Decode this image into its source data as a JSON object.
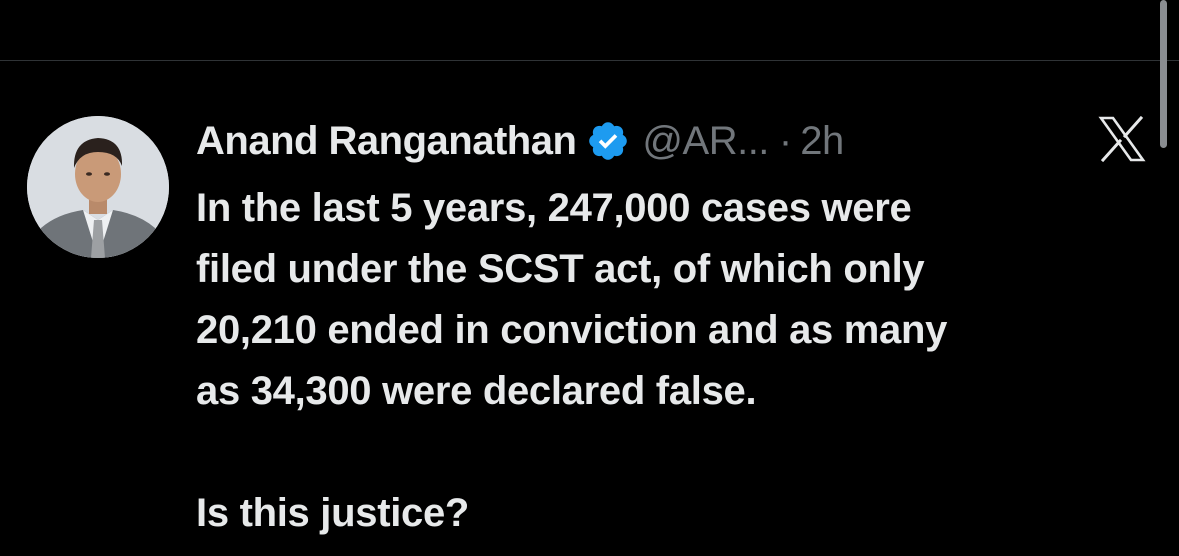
{
  "tweet": {
    "author_name": "Anand Ranganathan",
    "handle": "@AR...",
    "separator": "·",
    "time": "2h",
    "verified": true,
    "body_lines": [
      "In the last 5 years, 247,000 cases were",
      "filed under the SCST act, of which only",
      "20,210 ended in conviction and as many",
      "as 34,300 were declared false."
    ],
    "question": "Is this justice?"
  },
  "icons": {
    "avatar": "avatar-portrait",
    "verified": "verified-badge-icon",
    "app_logo": "x-logo-icon"
  },
  "colors": {
    "background": "#000000",
    "text_primary": "#e7e9ea",
    "text_secondary": "#71767b",
    "verified_blue": "#1d9bf0"
  }
}
